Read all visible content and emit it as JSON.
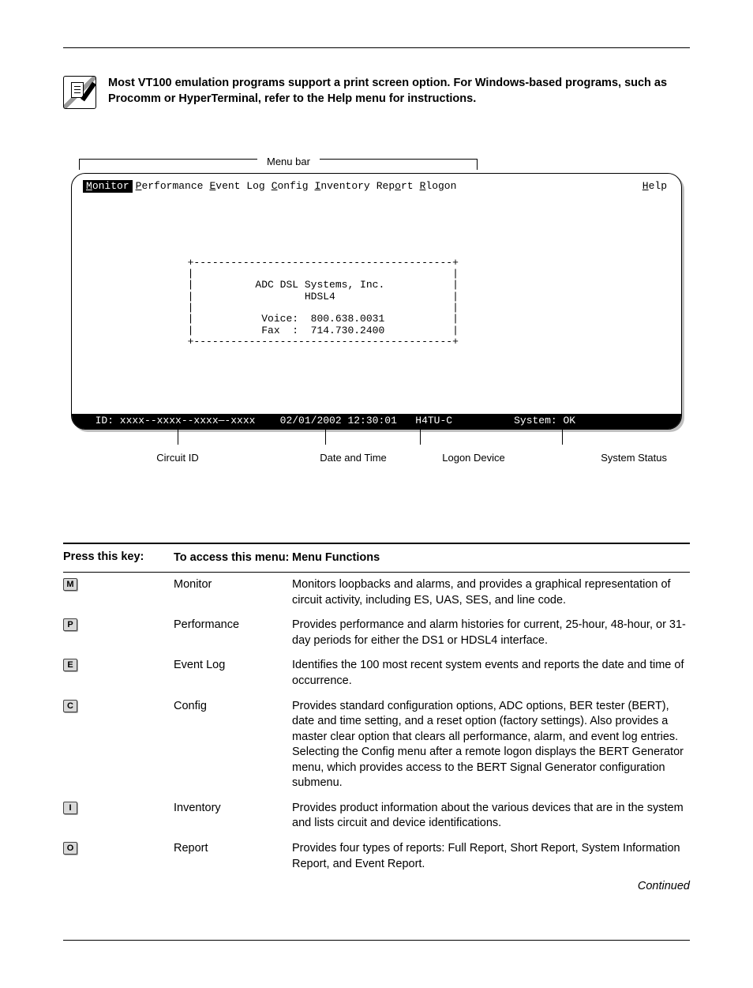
{
  "note": {
    "text": "Most VT100 emulation programs support a print screen option. For Windows-based programs, such as Procomm or HyperTerminal, refer to the Help menu for instructions."
  },
  "figure": {
    "menubar_label": "Menu bar",
    "menu_items": [
      {
        "hot": "M",
        "rest": "onitor",
        "selected": true
      },
      {
        "hot": "P",
        "rest": "erformance",
        "selected": false
      },
      {
        "hot": "E",
        "rest": "vent Log",
        "selected": false
      },
      {
        "hot": "C",
        "rest": "onfig",
        "selected": false
      },
      {
        "hot": "I",
        "rest": "nventory",
        "selected": false
      },
      {
        "hot": "o",
        "prefix": "Rep",
        "rest": "rt",
        "selected": false
      },
      {
        "hot": "R",
        "rest": "logon",
        "selected": false
      },
      {
        "hot": "H",
        "rest": "elp",
        "selected": false,
        "right": true
      }
    ],
    "box_lines": {
      "company": "ADC DSL Systems, Inc.",
      "product": "HDSL4",
      "voice": "Voice:  800.638.0031",
      "fax": "Fax  :  714.730.2400"
    },
    "status": {
      "id_label": "ID:",
      "id": "xxxx--xxxx--xxxx—-xxxx",
      "datetime": "02/01/2002 12:30:01",
      "device": "H4TU-C",
      "system_label": "System:",
      "system_value": "OK"
    },
    "callouts": {
      "circuit_id": "Circuit ID",
      "datetime": "Date and Time",
      "logon_device": "Logon Device",
      "system_status": "System Status"
    }
  },
  "table": {
    "headers": {
      "key": "Press this key:",
      "menu": "To access this menu:",
      "func": "Menu Functions"
    },
    "rows": [
      {
        "key": "M",
        "menu": "Monitor",
        "func": "Monitors loopbacks and alarms, and provides a graphical representation of circuit activity, including ES, UAS, SES, and line code."
      },
      {
        "key": "P",
        "menu": "Performance",
        "func": "Provides performance and alarm histories for current, 25-hour, 48-hour, or 31-day periods for either the DS1 or HDSL4 interface."
      },
      {
        "key": "E",
        "menu": "Event Log",
        "func": "Identifies the 100 most recent system events and reports the date and time of occurrence."
      },
      {
        "key": "C",
        "menu": "Config",
        "func": "Provides standard configuration options, ADC options, BER tester (BERT), date and time setting, and a reset option (factory settings). Also provides a master clear option that clears all performance, alarm, and event log entries. Selecting the Config menu after a remote logon displays the BERT Generator menu, which provides access to the BERT Signal Generator configuration submenu."
      },
      {
        "key": "I",
        "menu": "Inventory",
        "func": "Provides product information about the various devices that are in the system and lists circuit and device identifications."
      },
      {
        "key": "O",
        "menu": "Report",
        "func": "Provides four types of reports: Full Report, Short Report, System Information Report, and Event Report."
      }
    ],
    "continued": "Continued"
  }
}
